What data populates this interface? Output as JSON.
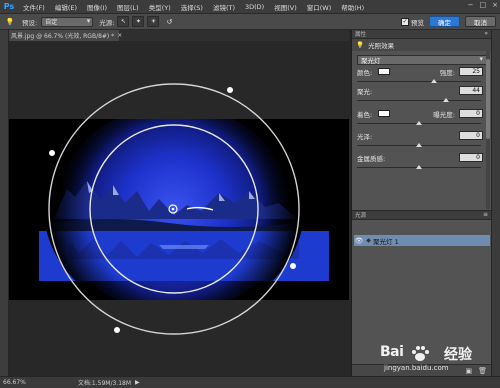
{
  "app": {
    "logo": "Ps",
    "menu": [
      "文件(F)",
      "编辑(E)",
      "图像(I)",
      "图层(L)",
      "类型(Y)",
      "选择(S)",
      "滤镜(T)",
      "3D(D)",
      "视图(V)",
      "窗口(W)",
      "帮助(H)"
    ],
    "window_controls": [
      "−",
      "□",
      "×"
    ]
  },
  "options_bar": {
    "preset_label": "预设:",
    "preset_value": "自定",
    "lights_label": "光源:",
    "tool_buttons": [
      "↖",
      "✦",
      "☀"
    ],
    "preview_label": "预览",
    "preview_checked": "✓",
    "ok_label": "确定",
    "cancel_label": "取消"
  },
  "document": {
    "tab_title": "风景.jpg @ 66.7% (光效, RGB/8#) *",
    "close_glyph": "×"
  },
  "properties_panel": {
    "header": "属性",
    "tab": "光照效果",
    "light_type": "聚光灯",
    "color_label": "颜色:",
    "intensity_label": "强度:",
    "intensity_value": "25",
    "hotspot_label": "聚光:",
    "hotspot_value": "44",
    "colorize_label": "着色:",
    "exposure_label": "曝光度:",
    "exposure_value": "0",
    "gloss_label": "光泽:",
    "gloss_value": "0",
    "metallic_label": "金属质感:",
    "metallic_value": "0",
    "intensity_level": 0.62,
    "hotspot_level": 0.72,
    "exposure_level": 0.5,
    "gloss_level": 0.5,
    "metallic_level": 0.5
  },
  "lights_panel": {
    "header": "光源",
    "light_name": "聚光灯 1",
    "eye_icon": "👁",
    "footer_icons": [
      "▣",
      "🗑"
    ]
  },
  "status_bar": {
    "zoom": "66.67%",
    "doc_info": "文档:1.59M/3.18M",
    "arrow": "▶"
  },
  "watermark": {
    "brand": "Bai",
    "brand_suffix": "经验",
    "url": "jingyan.baidu.com"
  },
  "colors": {
    "accent": "#2b78d6",
    "selection_row": "#6f8cb3",
    "photo_blue": "#1a2cc8"
  }
}
